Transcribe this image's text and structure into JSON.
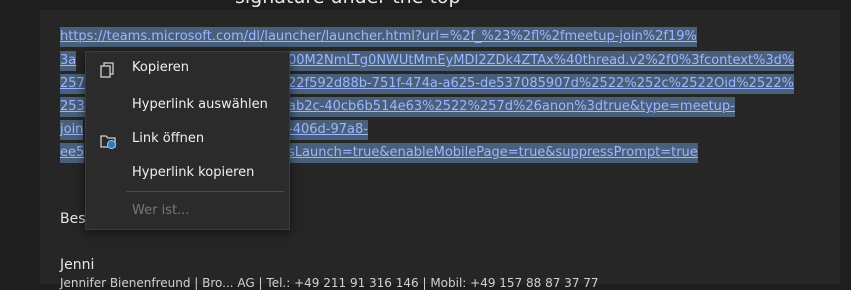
{
  "top_text": "signature under the top",
  "link_lines": [
    "https://teams.microsoft.com/dl/launcher/launcher.html?url=%2f_%23%2fl%2fmeetup-join%2f19%",
    "3a",
    "00M2NmLTg0NWUtMmEyMDI2ZDk4ZTAx%40thread.v2%2f0%3fcontext%3d%",
    "257",
    "22f592d88b-751f-474a-a625-de537085907d%2522%252c%2522Oid%2522%",
    "253",
    "ab2c-40cb6b514e63%2522%257d%26anon%3dtrue&type=meetup-",
    "join",
    "-406d-97a8-",
    "ee5",
    "sLaunch=true&enableMobilePage=true&suppressPrompt=true"
  ],
  "signature": {
    "greeting": "Bes",
    "name": "Jenni",
    "contact_line": "Jennifer Bienenfreund | Bro... AG | Tel.: +49 211 91 316 146 | Mobil: +49 157 88 87 37 77"
  },
  "context_menu": {
    "items": [
      {
        "label": "Kopieren",
        "icon": "copy-icon",
        "enabled": true
      },
      {
        "label": "Hyperlink auswählen",
        "icon": "",
        "enabled": true
      },
      {
        "label": "Link öffnen",
        "icon": "open-link-icon",
        "enabled": true
      },
      {
        "label": "Hyperlink kopieren",
        "icon": "",
        "enabled": true
      },
      {
        "label": "Wer ist...",
        "icon": "",
        "enabled": false
      }
    ]
  },
  "colors": {
    "link": "#9bb7ff",
    "selection": "#4a5f7a",
    "menu_bg": "#2b2b2b",
    "brand": "#e05050"
  }
}
